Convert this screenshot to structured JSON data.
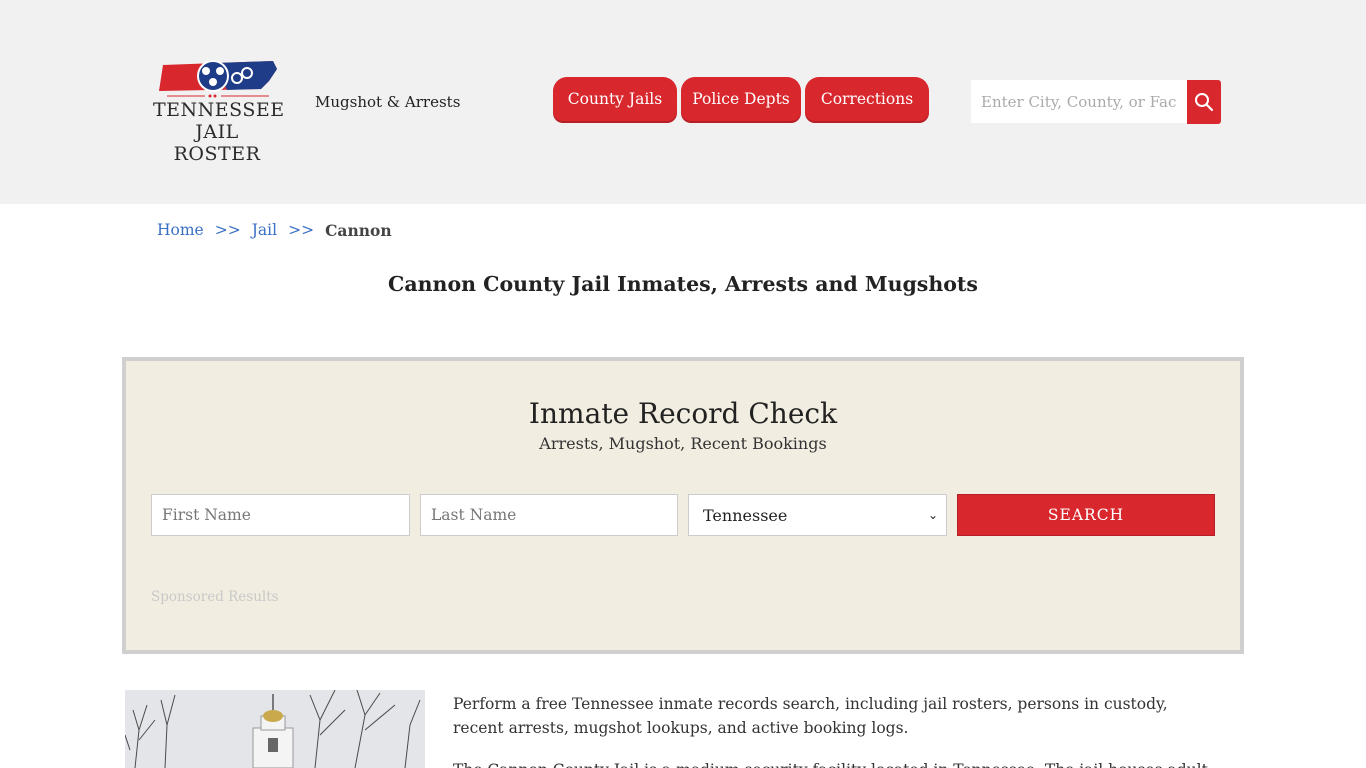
{
  "header": {
    "logo_line1": "TENNESSEE",
    "logo_line2": "JAIL ROSTER",
    "tagline": "Mugshot & Arrests",
    "nav": [
      {
        "label": "County Jails"
      },
      {
        "label": "Police Depts"
      },
      {
        "label": "Corrections"
      }
    ],
    "search_placeholder": "Enter City, County, or Facility",
    "colors": {
      "accent": "#d9272e",
      "header_bg": "#f1f1f1",
      "logo_blue": "#1f3c88"
    }
  },
  "breadcrumb": {
    "home": "Home",
    "sep": ">>",
    "jail": "Jail",
    "current": "Cannon"
  },
  "page_title": "Cannon County Jail Inmates, Arrests and Mugshots",
  "record_check": {
    "title": "Inmate Record Check",
    "subtitle": "Arrests, Mugshot, Recent Bookings",
    "first_placeholder": "First Name",
    "last_placeholder": "Last Name",
    "state_selected": "Tennessee",
    "search_label": "SEARCH",
    "sponsored": "Sponsored Results",
    "panel_bg": "#f1eee1"
  },
  "content": {
    "para1": "Perform a free Tennessee inmate records search, including jail rosters, persons in custody, recent arrests, mugshot lookups, and active booking logs.",
    "para2": "The Cannon County Jail is a medium security facility located in Tennessee. The jail houses adult"
  }
}
